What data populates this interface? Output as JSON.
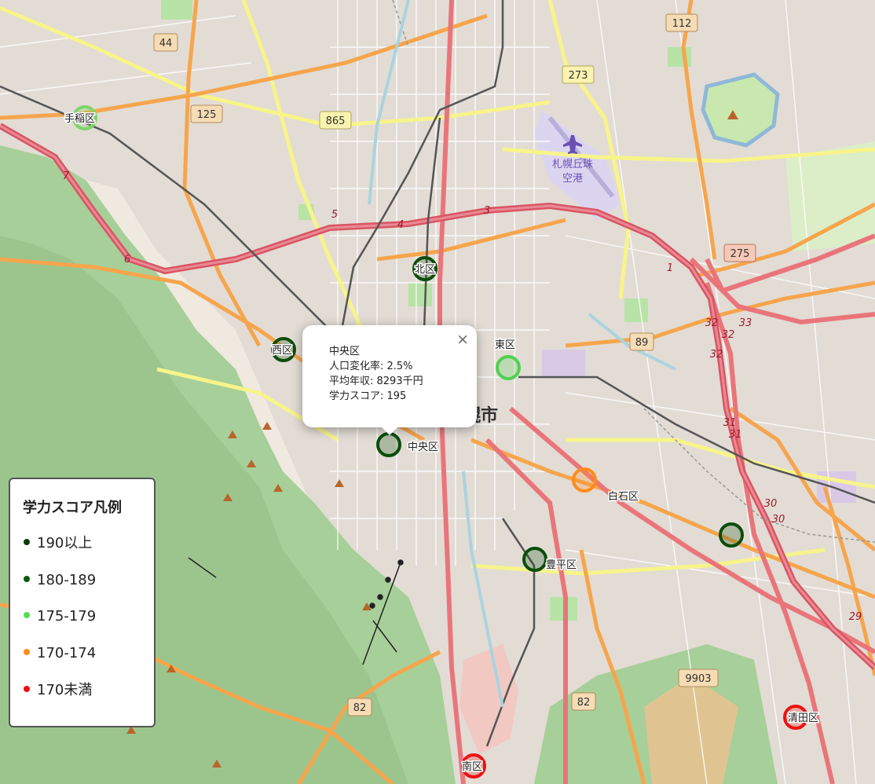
{
  "map_labels": {
    "road_44": "44",
    "road_125": "125",
    "road_865": "865",
    "road_112": "112",
    "road_273": "273",
    "road_275": "275",
    "road_89": "89",
    "road_9903": "9903",
    "road_82_a": "82",
    "road_82_b": "82",
    "ring_5": "5",
    "ring_4": "4",
    "ring_3": "3",
    "ring_6": "6",
    "ring_7": "7",
    "ring_1": "1",
    "route_32_a": "32",
    "route_32_b": "32",
    "route_32_c": "32",
    "route_33": "33",
    "route_31_a": "31",
    "route_31_b": "31",
    "route_30_a": "30",
    "route_30_b": "30",
    "route_29": "29",
    "airport_line1": "札幌丘珠",
    "airport_line2": "空港",
    "city": "幌市"
  },
  "districts": [
    {
      "name": "手稲区",
      "color": "#7fd36a"
    },
    {
      "name": "北区",
      "color": "#0b4d0b"
    },
    {
      "name": "西区",
      "color": "#0b4d0b"
    },
    {
      "name": "東区",
      "color": "#4fd14f"
    },
    {
      "name": "中央区",
      "color": "#0b4d0b"
    },
    {
      "name": "白石区",
      "color": "#ff8c1a"
    },
    {
      "name": "豊平区",
      "color": "#0b4d0b"
    },
    {
      "name": "",
      "color": "#0b4d0b"
    },
    {
      "name": "清田区",
      "color": "#ee1111"
    },
    {
      "name": "南区",
      "color": "#ee1111"
    }
  ],
  "popup": {
    "district": "中央区",
    "line1": "人口変化率: 2.5%",
    "line2": "平均年収: 8293千円",
    "line3": "学力スコア: 195",
    "close": "×"
  },
  "legend": {
    "title": "学力スコア凡例",
    "items": [
      {
        "label": "190以上",
        "color": "#0b3d0b"
      },
      {
        "label": "180-189",
        "color": "#0b5a0b"
      },
      {
        "label": "175-179",
        "color": "#55dd55"
      },
      {
        "label": "170-174",
        "color": "#ff8c1a"
      },
      {
        "label": "170未満",
        "color": "#ee1111"
      }
    ]
  }
}
